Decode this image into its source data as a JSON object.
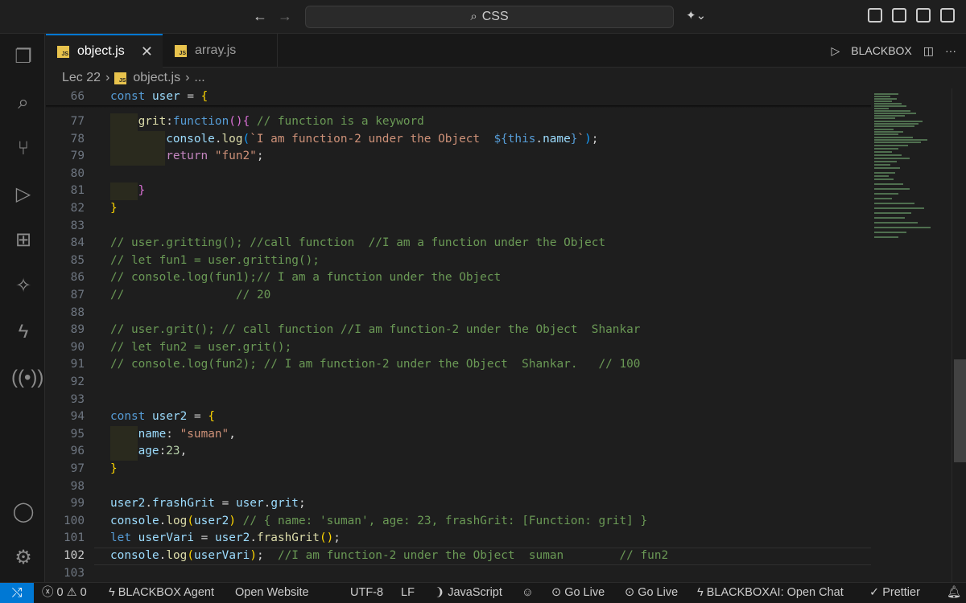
{
  "titlebar": {
    "search_text": "CSS"
  },
  "tabs": [
    {
      "label": "object.js",
      "badge": "JS",
      "active": true
    },
    {
      "label": "array.js",
      "badge": "JS",
      "active": false
    }
  ],
  "tab_actions": {
    "blackbox_label": "BLACKBOX"
  },
  "breadcrumb": {
    "folder": "Lec 22",
    "file": "object.js",
    "more": "..."
  },
  "editor": {
    "current_line": "102"
  },
  "statusbar": {
    "problems_errors": "0",
    "problems_warnings": "0",
    "blackbox_agent": "BLACKBOX Agent",
    "open_website": "Open Website",
    "encoding": "UTF-8",
    "eol": "LF",
    "language": "JavaScript",
    "go_live_1": "Go Live",
    "go_live_2": "Go Live",
    "blackbox_ai": "BLACKBOXAI: Open Chat",
    "prettier": "Prettier"
  },
  "colors": {
    "accent": "#0078d4",
    "comment": "#6a9955",
    "keyword": "#569cd6",
    "string": "#ce9178"
  }
}
